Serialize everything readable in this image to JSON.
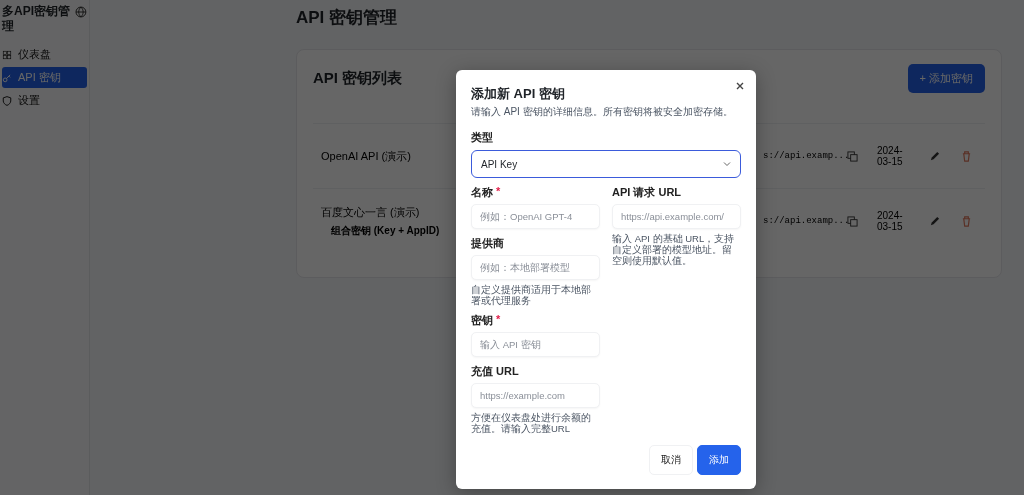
{
  "sidebar": {
    "title": "多API密钥管理",
    "items": [
      {
        "label": "仪表盘",
        "selected": false
      },
      {
        "label": "API 密钥",
        "selected": true
      },
      {
        "label": "设置",
        "selected": false
      }
    ]
  },
  "page_title": "API 密钥管理",
  "card": {
    "title": "API 密钥列表",
    "add_button": "+ 添加密钥",
    "rows": [
      {
        "name": "OpenAI API (演示)",
        "url": "s://api.examp...",
        "date": "2024-03-15"
      },
      {
        "name": "百度文心一言 (演示)",
        "subtitle": "组合密钥 (Key + AppID)",
        "url": "s://api.examp...",
        "date": "2024-03-15"
      }
    ]
  },
  "dialog": {
    "title": "添加新 API 密钥",
    "description": "请输入 API 密钥的详细信息。所有密钥将被安全加密存储。",
    "type_label": "类型",
    "type_value": "API Key",
    "left_fields": [
      {
        "label": "名称",
        "required_mark": "*",
        "placeholder": "例如：OpenAI GPT-4"
      },
      {
        "label": "提供商",
        "placeholder": "例如：本地部署模型",
        "hint": "自定义提供商适用于本地部署或代理服务"
      },
      {
        "label": "密钥",
        "required_mark": "*",
        "placeholder": "输入 API 密钥"
      },
      {
        "label": "充值 URL",
        "placeholder": "https://example.com",
        "hint": "方便在仪表盘处进行余额的充值。请输入完整URL"
      }
    ],
    "right_fields": [
      {
        "label": "API 请求 URL",
        "placeholder": "https://api.example.com/",
        "hint": "输入 API 的基础 URL，支持自定义部署的模型地址。留空则使用默认值。"
      }
    ],
    "cancel_button": "取消",
    "submit_button": "添加"
  }
}
